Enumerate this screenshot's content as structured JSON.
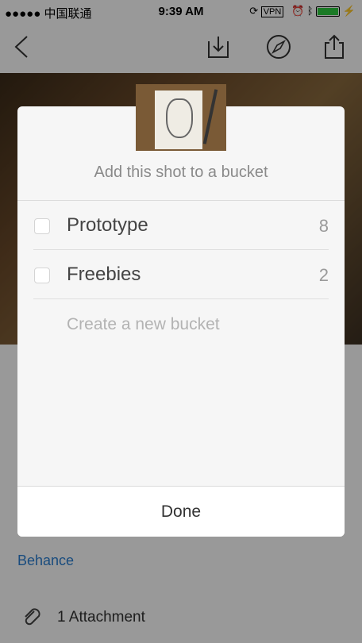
{
  "status_bar": {
    "carrier": "●●●●● 中国联通",
    "time": "9:39 AM",
    "vpn": "VPN"
  },
  "nav": {
    "icons": [
      "chevron-left-icon",
      "save-to-tray-icon",
      "compass-icon",
      "share-icon"
    ]
  },
  "background": {
    "behance_link": "Behance",
    "attachment_label": "1 Attachment"
  },
  "modal": {
    "title": "Add this shot to a bucket",
    "buckets": [
      {
        "name": "Prototype",
        "count": "8"
      },
      {
        "name": "Freebies",
        "count": "2"
      }
    ],
    "create_placeholder": "Create a new bucket",
    "done_label": "Done"
  },
  "colors": {
    "link": "#2a7fd2",
    "battery": "#2ecc40"
  }
}
